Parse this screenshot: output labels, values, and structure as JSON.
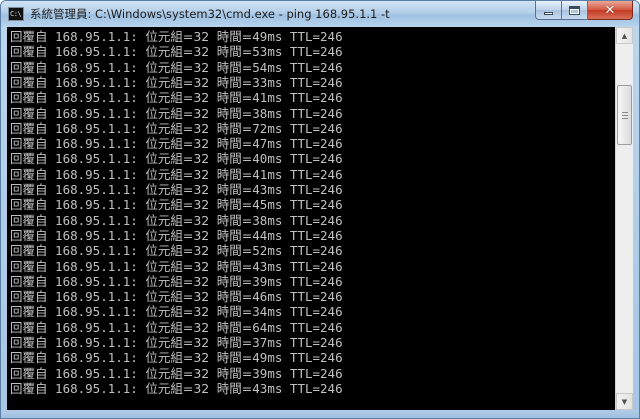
{
  "window": {
    "title": "系統管理員: C:\\Windows\\system32\\cmd.exe - ping  168.95.1.1 -t",
    "app_icon": "cmd-icon",
    "app_icon_text": "C:\\",
    "controls": {
      "minimize": "minimize-icon",
      "maximize": "maximize-icon",
      "close": "close-icon",
      "close_glyph": "✕"
    }
  },
  "console": {
    "reply_prefix": "回覆自",
    "host": "168.95.1.1:",
    "bytes_label": "位元組=32",
    "time_label": "時間=",
    "ttl_label": "TTL=246",
    "times": [
      "49ms",
      "53ms",
      "54ms",
      "33ms",
      "41ms",
      "38ms",
      "72ms",
      "47ms",
      "40ms",
      "41ms",
      "43ms",
      "45ms",
      "38ms",
      "44ms",
      "52ms",
      "43ms",
      "39ms",
      "46ms",
      "34ms",
      "64ms",
      "37ms",
      "49ms",
      "39ms",
      "43ms"
    ]
  },
  "scrollbar": {
    "up_glyph": "▲",
    "down_glyph": "▼"
  }
}
